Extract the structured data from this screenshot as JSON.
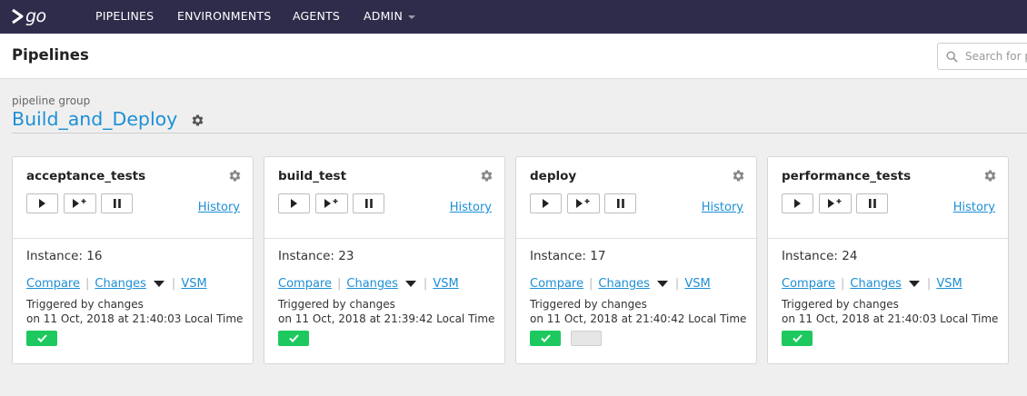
{
  "nav": {
    "logo": "go",
    "items": [
      "PIPELINES",
      "ENVIRONMENTS",
      "AGENTS",
      "ADMIN"
    ]
  },
  "page": {
    "title": "Pipelines",
    "search_placeholder": "Search for p"
  },
  "group": {
    "label": "pipeline group",
    "name": "Build_and_Deploy"
  },
  "colors": {
    "nav_bg": "#2f2c4b",
    "link": "#1d8fd6",
    "passed": "#1dc95f"
  },
  "pipelines": [
    {
      "name": "acceptance_tests",
      "history": "History",
      "instance": "Instance: 16",
      "compare": "Compare",
      "changes": "Changes",
      "vsm": "VSM",
      "triggered": "Triggered by changes",
      "on": "on 11 Oct, 2018 at 21:40:03 Local Time",
      "stages": [
        "passed"
      ]
    },
    {
      "name": "build_test",
      "history": "History",
      "instance": "Instance: 23",
      "compare": "Compare",
      "changes": "Changes",
      "vsm": "VSM",
      "triggered": "Triggered by changes",
      "on": "on 11 Oct, 2018 at 21:39:42 Local Time",
      "stages": [
        "passed"
      ]
    },
    {
      "name": "deploy",
      "history": "History",
      "instance": "Instance: 17",
      "compare": "Compare",
      "changes": "Changes",
      "vsm": "VSM",
      "triggered": "Triggered by changes",
      "on": "on 11 Oct, 2018 at 21:40:42 Local Time",
      "stages": [
        "passed",
        "not-run"
      ]
    },
    {
      "name": "performance_tests",
      "history": "History",
      "instance": "Instance: 24",
      "compare": "Compare",
      "changes": "Changes",
      "vsm": "VSM",
      "triggered": "Triggered by changes",
      "on": "on 11 Oct, 2018 at 21:40:03 Local Time",
      "stages": [
        "passed"
      ]
    }
  ]
}
